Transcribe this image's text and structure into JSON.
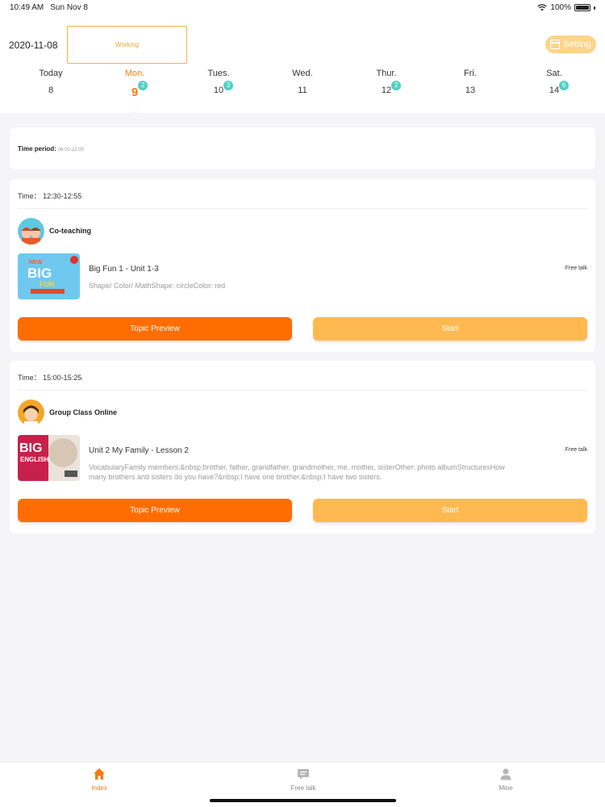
{
  "status_bar": {
    "time": "10:49 AM",
    "date": "Sun Nov 8",
    "battery": "100%"
  },
  "header": {
    "date": "2020-11-08",
    "status_box": "Working",
    "setting_label": "Setting",
    "days": [
      {
        "name": "Today",
        "num": "8",
        "badge": ""
      },
      {
        "name": "Mon.",
        "num": "9",
        "badge": "2",
        "active": true
      },
      {
        "name": "Tues.",
        "num": "10",
        "badge": "3"
      },
      {
        "name": "Wed.",
        "num": "11",
        "badge": ""
      },
      {
        "name": "Thur.",
        "num": "12",
        "badge": "2"
      },
      {
        "name": "Fri.",
        "num": "13",
        "badge": ""
      },
      {
        "name": "Sat.",
        "num": "14",
        "badge": "6"
      }
    ]
  },
  "period": {
    "label": "Time period:",
    "value": "06:00-22:00"
  },
  "lessons": [
    {
      "time": "Time：  12:30-12:55",
      "type": "Co-teaching",
      "title": "Big Fun 1 - Unit 1-3",
      "description": "Shape/ Color/ MathShape: circleColor: red",
      "tag": "Free talk",
      "preview_label": "Topic Preview",
      "start_label": "Start"
    },
    {
      "time": "Time：  15:00-15:25",
      "type": "Group Class Online",
      "title": "Unit 2 My Family - Lesson 2",
      "description": "VocabularyFamily members:&nbsp;brother, father, grandfather, grandmother, me, mother, sisterOther: photo albumStructuresHow many brothers and sisters do you have?&nbsp;I have one brother.&nbsp;I have two sisters.",
      "tag": "Free talk",
      "preview_label": "Topic Preview",
      "start_label": "Start"
    }
  ],
  "tabbar": {
    "items": [
      {
        "label": "Index",
        "icon": "home-icon",
        "active": true
      },
      {
        "label": "Free talk",
        "icon": "chat-icon"
      },
      {
        "label": "Mine",
        "icon": "person-icon"
      }
    ]
  },
  "colors": {
    "accent": "#ff6d00",
    "accent_light": "#ffb950",
    "badge": "#4fd0c4",
    "active_text": "#f47b16"
  }
}
